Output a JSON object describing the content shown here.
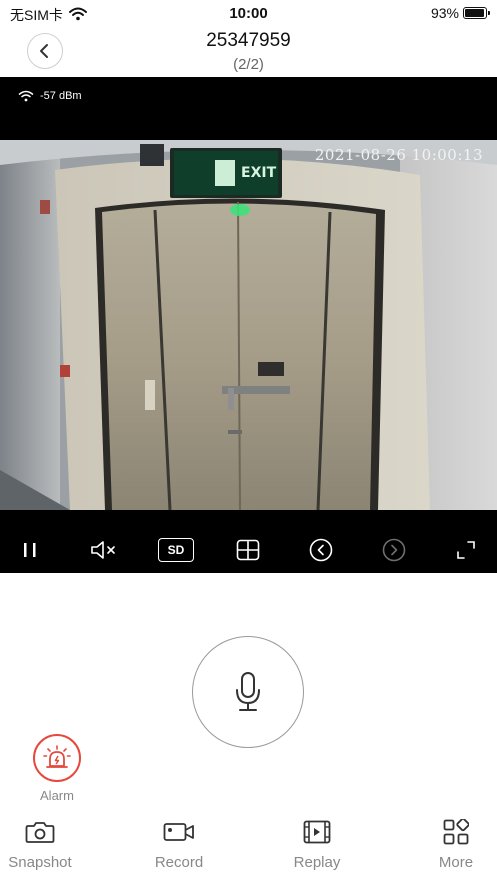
{
  "status_bar": {
    "carrier": "无SIM卡",
    "time": "10:00",
    "battery_percent": "93%",
    "battery_level": 0.93,
    "icons": [
      "wifi-icon",
      "battery-icon"
    ]
  },
  "nav": {
    "back_icon": "chevron-left-icon",
    "title": "25347959",
    "subtitle": "(2/2)"
  },
  "video": {
    "signal_text": "-57 dBm",
    "timestamp": "2021-08-26 10:00:13",
    "exit_sign": "EXIT",
    "controls": [
      {
        "name": "pause",
        "icon": "pause-icon"
      },
      {
        "name": "mute",
        "icon": "speaker-muted-icon"
      },
      {
        "name": "quality",
        "label": "SD"
      },
      {
        "name": "split",
        "icon": "grid-icon"
      },
      {
        "name": "previous",
        "icon": "prev-circle-icon"
      },
      {
        "name": "next",
        "icon": "next-circle-icon",
        "disabled": true
      },
      {
        "name": "fullscreen",
        "icon": "fullscreen-icon"
      }
    ]
  },
  "talk": {
    "icon": "microphone-icon"
  },
  "alarm": {
    "label": "Alarm",
    "color": "#e5483c",
    "icon": "siren-icon"
  },
  "tabs": [
    {
      "label": "Snapshot",
      "icon": "camera-icon"
    },
    {
      "label": "Record",
      "icon": "video-camera-icon"
    },
    {
      "label": "Replay",
      "icon": "film-play-icon"
    },
    {
      "label": "More",
      "icon": "more-grid-icon"
    }
  ]
}
